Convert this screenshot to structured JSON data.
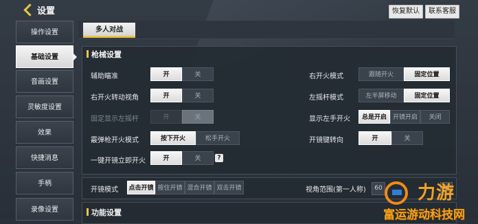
{
  "header": {
    "title": "设置",
    "restore_default": "恢复默认",
    "contact_support": "联系客服"
  },
  "sidebar": {
    "items": [
      {
        "label": "操作设置"
      },
      {
        "label": "基础设置"
      },
      {
        "label": "音画设置"
      },
      {
        "label": "灵敏度设置"
      },
      {
        "label": "效果"
      },
      {
        "label": "快捷消息"
      },
      {
        "label": "手柄"
      },
      {
        "label": "录像设置"
      }
    ],
    "active_index": 1
  },
  "tabs": {
    "multiplayer": "多人对战"
  },
  "gun_settings": {
    "title": "枪械设置",
    "aim_assist": {
      "label": "辅助瞄准",
      "on": "开",
      "off": "关"
    },
    "fire_turn_view": {
      "label": "右开火转动视角",
      "on": "开",
      "off": "关"
    },
    "fixed_left_stick": {
      "label": "固定显示左摇杆",
      "on": "开",
      "off": "关"
    },
    "sniper_fire_mode": {
      "label": "霰弹枪开火模式",
      "press": "按下开火",
      "release": "松手开火"
    },
    "one_key_scope_fire": {
      "label": "一键开镜立即开火",
      "on": "开",
      "off": "关",
      "help": "?"
    },
    "right_fire_mode": {
      "label": "右开火模式",
      "follow": "跟随开火",
      "fixed": "固定位置"
    },
    "left_stick_mode": {
      "label": "左摇杆模式",
      "left_half": "左半屏移动",
      "fixed": "固定位置"
    },
    "show_left_fire": {
      "label": "显示左手开火",
      "always": "总是开启",
      "scope_on": "开镜开启",
      "close": "关闭"
    },
    "scope_key_turn": {
      "label": "开镜键转向",
      "on": "开",
      "off": "关"
    }
  },
  "scope_mode": {
    "label": "开镜模式",
    "options": [
      "点击开镜",
      "按住开镜",
      "混合开镜",
      "双击开镜"
    ],
    "selected": "点击开镜"
  },
  "fov": {
    "label": "视角范围(第一人称)",
    "value": "60",
    "plus": "+"
  },
  "function_settings": {
    "title": "功能设置"
  },
  "watermark": {
    "big": "力游",
    "text": "富运游动科技网"
  },
  "colors": {
    "accent": "#e8c548",
    "watermark": "#f3a21f"
  }
}
